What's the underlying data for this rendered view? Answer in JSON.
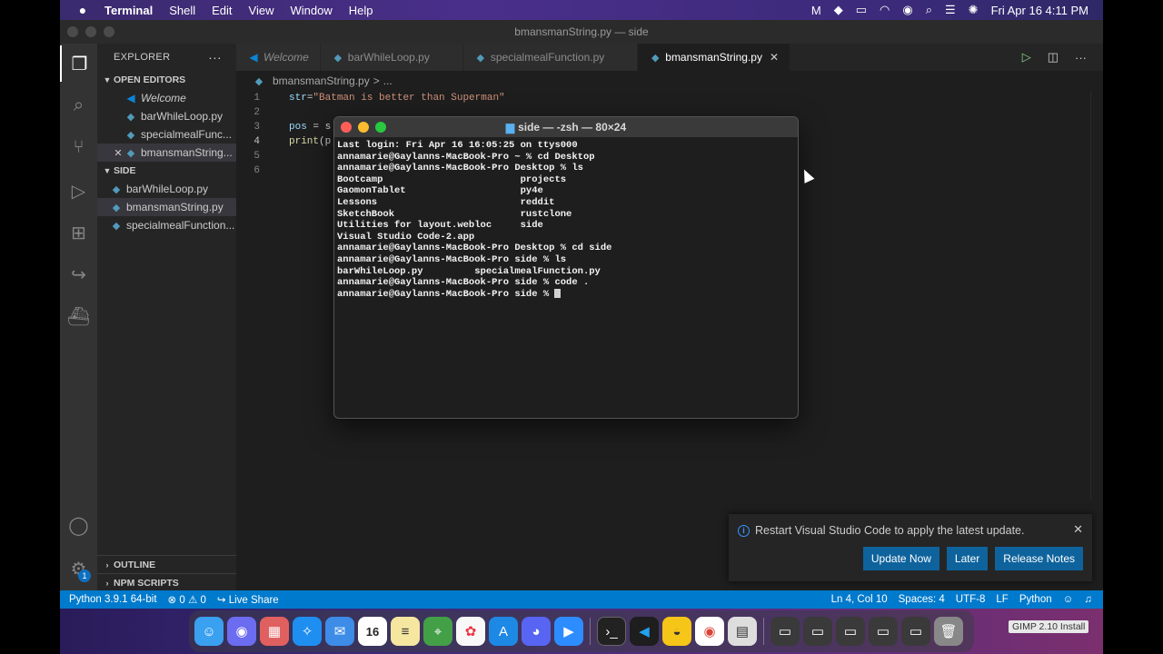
{
  "menubar": {
    "apple": "",
    "app_name": "Terminal",
    "items": [
      "Shell",
      "Edit",
      "View",
      "Window",
      "Help"
    ],
    "datetime": "Fri Apr 16  4:11 PM",
    "status_icons": [
      "malwarebytes-icon",
      "shield-icon",
      "battery-icon",
      "wifi-icon",
      "user-icon",
      "search-icon",
      "control-center-icon",
      "siri-icon"
    ]
  },
  "window": {
    "title": "bmansmanString.py — side"
  },
  "activity_bar": {
    "badge": "1"
  },
  "sidebar": {
    "header": "EXPLORER",
    "more": "···",
    "open_editors_label": "OPEN EDITORS",
    "open_editors": [
      {
        "label": "Welcome",
        "icon": "vscode-icon"
      },
      {
        "label": "barWhileLoop.py",
        "icon": "python-icon"
      },
      {
        "label": "specialmealFunc...",
        "icon": "python-icon"
      },
      {
        "label": "bmansmanString...",
        "icon": "python-icon"
      }
    ],
    "folder_label": "SIDE",
    "files": [
      "barWhileLoop.py",
      "bmansmanString.py",
      "specialmealFunction..."
    ],
    "outline_label": "OUTLINE",
    "npm_label": "NPM SCRIPTS"
  },
  "tabs": [
    {
      "label": "Welcome",
      "icon": "vscode-icon"
    },
    {
      "label": "barWhileLoop.py",
      "icon": "python-icon"
    },
    {
      "label": "specialmealFunction.py",
      "icon": "python-icon"
    },
    {
      "label": "bmansmanString.py",
      "icon": "python-icon",
      "active": true
    }
  ],
  "breadcrumb": {
    "file": "bmansmanString.py",
    "sep": ">",
    "rest": "..."
  },
  "editor": {
    "lines": [
      {
        "num": "1",
        "parts": [
          [
            "var",
            "str"
          ],
          [
            "plain",
            "="
          ],
          [
            "str",
            "\"Batman is better than Superman\""
          ]
        ]
      },
      {
        "num": "2",
        "parts": []
      },
      {
        "num": "3",
        "parts": [
          [
            "var",
            "pos"
          ],
          [
            "plain",
            " = s"
          ]
        ]
      },
      {
        "num": "4",
        "parts": [
          [
            "fn",
            "print"
          ],
          [
            "plain",
            "(p"
          ]
        ]
      },
      {
        "num": "5",
        "parts": []
      },
      {
        "num": "6",
        "parts": []
      }
    ]
  },
  "terminal": {
    "title": "side — -zsh — 80×24",
    "lines": [
      "Last login: Fri Apr 16 16:05:25 on ttys000",
      "annamarie@Gaylanns-MacBook-Pro ~ % cd Desktop",
      "annamarie@Gaylanns-MacBook-Pro Desktop % ls",
      "Bootcamp                        projects",
      "GaomonTablet                    py4e",
      "Lessons                         reddit",
      "SketchBook                      rustclone",
      "Utilities for layout.webloc     side",
      "Visual Studio Code-2.app",
      "annamarie@Gaylanns-MacBook-Pro Desktop % cd side",
      "annamarie@Gaylanns-MacBook-Pro side % ls",
      "barWhileLoop.py         specialmealFunction.py",
      "annamarie@Gaylanns-MacBook-Pro side % code .",
      "annamarie@Gaylanns-MacBook-Pro side % "
    ]
  },
  "notification": {
    "message": "Restart Visual Studio Code to apply the latest update.",
    "buttons": [
      "Update Now",
      "Later",
      "Release Notes"
    ]
  },
  "statusbar": {
    "python": "Python 3.9.1 64-bit",
    "problems": "⊗ 0 ⚠ 0",
    "liveshare": "Live Share",
    "position": "Ln 4, Col 10",
    "spaces": "Spaces: 4",
    "encoding": "UTF-8",
    "eol": "LF",
    "language": "Python"
  },
  "dock": {
    "calendar_day": "16",
    "gimp_label": "GIMP 2.10 Install"
  }
}
